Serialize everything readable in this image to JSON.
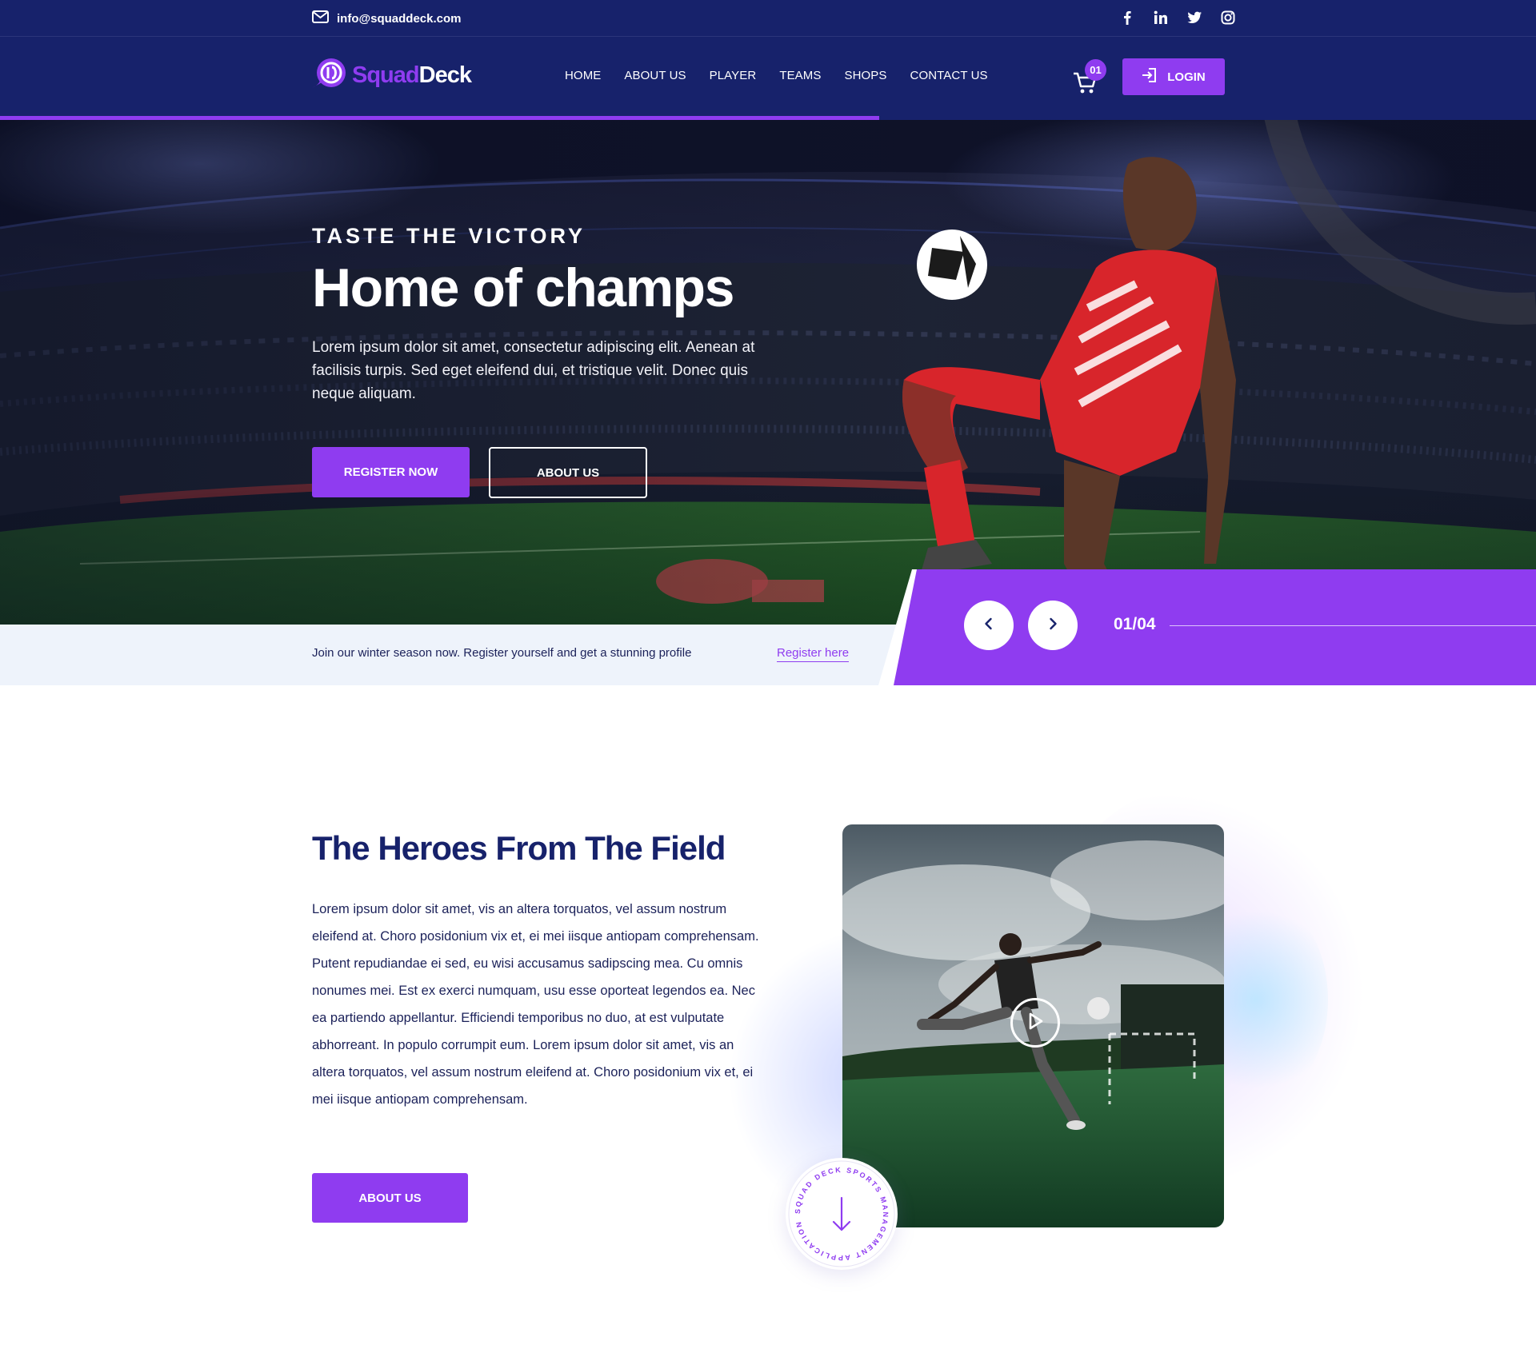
{
  "topbar": {
    "email": "info@squaddeck.com",
    "social": [
      "facebook-icon",
      "linkedin-icon",
      "twitter-icon",
      "instagram-icon"
    ]
  },
  "header": {
    "logo": {
      "part1": "Squad",
      "part2": "Deck"
    },
    "nav": [
      "HOME",
      "ABOUT US",
      "PLAYER",
      "TEAMS",
      "SHOPS",
      "CONTACT US"
    ],
    "cart_count": "01",
    "login_label": "LOGIN"
  },
  "hero": {
    "kicker": "TASTE THE VICTORY",
    "title": "Home of champs",
    "description": "Lorem ipsum dolor sit amet, consectetur adipiscing elit. Aenean at facilisis turpis. Sed eget eleifend dui, et tristique velit. Donec quis neque aliquam.",
    "primary_button": "REGISTER NOW",
    "secondary_button": "ABOUT US",
    "slide_counter": "01/04"
  },
  "strip": {
    "text": "Join our winter season now. Register yourself and get a stunning profile",
    "link": "Register here"
  },
  "about": {
    "title": "The Heroes From The Field",
    "body": "Lorem ipsum dolor sit amet, vis an altera torquatos, vel assum nostrum eleifend at. Choro posidonium vix et, ei mei iisque antiopam comprehensam. Putent repudiandae ei sed, eu wisi accusamus sadipscing mea. Cu omnis nonumes mei. Est ex exerci numquam, usu esse oporteat legendos ea. Nec ea partiendo appellantur. Efficiendi temporibus no duo, at est vulputate abhorreant. In populo corrumpit eum. Lorem ipsum dolor sit amet, vis an altera torquatos, vel assum nostrum eleifend at. Choro posidonium vix et, ei mei iisque antiopam comprehensam.",
    "button": "ABOUT US",
    "seal_text": "SQUAD DECK SPORTS MANAGEMENT APPLICATION"
  },
  "colors": {
    "navy": "#17226b",
    "purple": "#8f3cf0",
    "strip_bg": "#eef3fb"
  }
}
